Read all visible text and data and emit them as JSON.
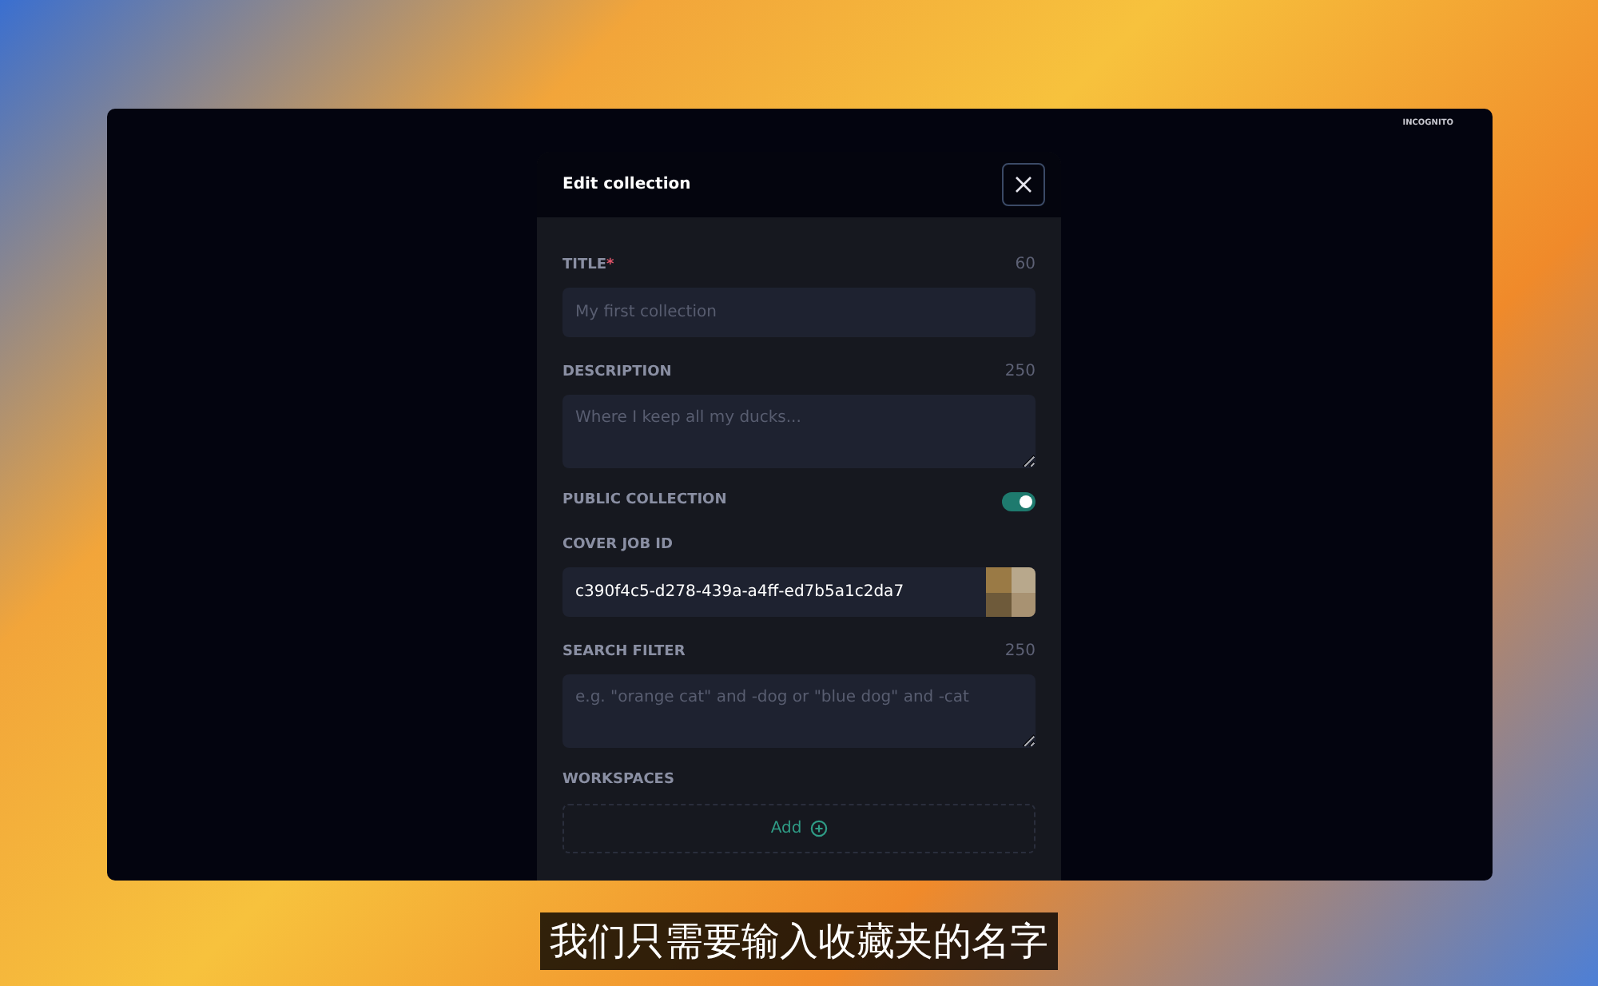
{
  "browser": {
    "badge": "INCOGNITO"
  },
  "dialog": {
    "title": "Edit collection",
    "fields": [
      {
        "kind": "text",
        "label": "TITLE",
        "required_mark": "*",
        "counter": "60",
        "placeholder": "My first collection"
      },
      {
        "kind": "textarea",
        "label": "DESCRIPTION",
        "counter": "250",
        "placeholder": "Where I keep all my ducks..."
      },
      {
        "kind": "toggle",
        "label": "PUBLIC COLLECTION",
        "on": true
      },
      {
        "kind": "image",
        "label": "COVER JOB ID",
        "value": "c390f4c5-d278-439a-a4ff-ed7b5a1c2da7"
      },
      {
        "kind": "textarea",
        "label": "SEARCH FILTER",
        "counter": "250",
        "placeholder": "e.g. \"orange cat\" and -dog or \"blue dog\" and -cat"
      },
      {
        "kind": "add",
        "label": "WORKSPACES",
        "button": "Add"
      }
    ]
  },
  "subtitle": "我们只需要输入收藏夹的名字"
}
